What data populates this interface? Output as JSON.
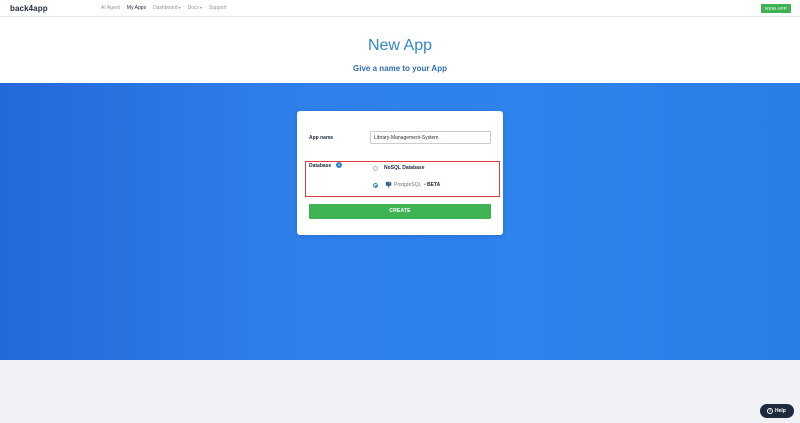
{
  "topnav": {
    "logo": "back4app",
    "links": [
      {
        "label": "AI Agent",
        "caret": ""
      },
      {
        "label": "My Apps",
        "caret": ""
      },
      {
        "label": "Dashboard",
        "caret": "▾"
      },
      {
        "label": "Docs",
        "caret": "▾"
      },
      {
        "label": "Support",
        "caret": ""
      }
    ],
    "active_link": "My Apps",
    "new_app_label": "NEW APP"
  },
  "header": {
    "title": "New App",
    "subtitle": "Give a name to your App"
  },
  "form": {
    "app_name_label": "App name",
    "app_name_value": "Library-Management-System",
    "database_label": "Database",
    "info_icon": "info-icon",
    "options": [
      {
        "label": "NoSQL Database",
        "selected": false
      },
      {
        "label": "PostgreSQL",
        "suffix": "BETA",
        "separator": "•",
        "selected": true
      }
    ],
    "create_label": "CREATE"
  },
  "help": {
    "label": "Help",
    "icon_glyph": "?"
  },
  "colors": {
    "accent_green": "#3fb254",
    "title_blue": "#2f87c9",
    "hero_blue": "#2f7fea",
    "highlight_red": "#e03c3c",
    "navy": "#1e2b3c"
  }
}
